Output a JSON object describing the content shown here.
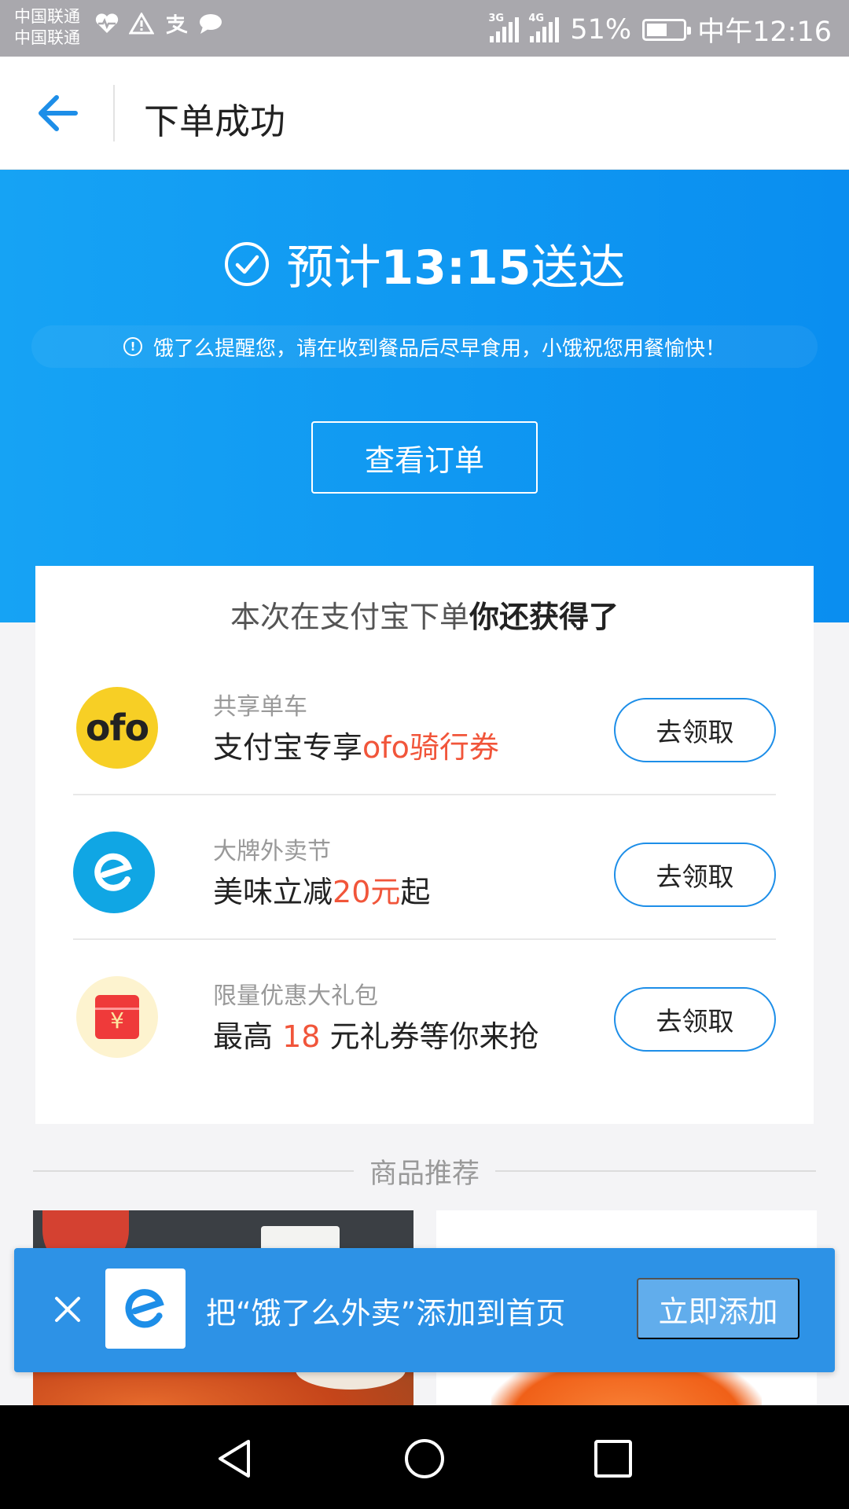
{
  "status_bar": {
    "carrier_1": "中国联通",
    "carrier_2": "中国联通",
    "network_1": "3G",
    "network_2": "4G",
    "battery": "51%",
    "time": "中午12:16"
  },
  "header": {
    "title": "下单成功",
    "back_icon": "arrow-left-icon"
  },
  "hero": {
    "eta_prefix": "预计",
    "eta_time": "13:15",
    "eta_suffix": "送达",
    "notice_icon": "!",
    "notice": "饿了么提醒您，请在收到餐品后尽早食用，小饿祝您用餐愉快！",
    "view_order_label": "查看订单"
  },
  "rewards": {
    "title_prefix": "本次在支付宝下单",
    "title_emphasis": "你还获得了",
    "items": [
      {
        "logo": "ofo",
        "subtitle": "共享单车",
        "main_prefix": "支付宝专享",
        "main_highlight": "ofo骑行券",
        "main_suffix": "",
        "button": "去领取"
      },
      {
        "logo": "ele-icon",
        "subtitle": "大牌外卖节",
        "main_prefix": "美味立减",
        "main_highlight": "20元",
        "main_suffix": "起",
        "button": "去领取"
      },
      {
        "logo": "¥",
        "subtitle": "限量优惠大礼包",
        "main_prefix": "最高 ",
        "main_highlight": "18",
        "main_suffix": " 元礼券等你来抢",
        "button": "去领取"
      }
    ]
  },
  "recommend": {
    "title": "商品推荐"
  },
  "banner": {
    "text": "把“饿了么外卖”添加到首页",
    "add_label": "立即添加"
  },
  "colors": {
    "accent": "#0a8ef0",
    "highlight": "#f1553a",
    "banner": "#2d92e6"
  }
}
